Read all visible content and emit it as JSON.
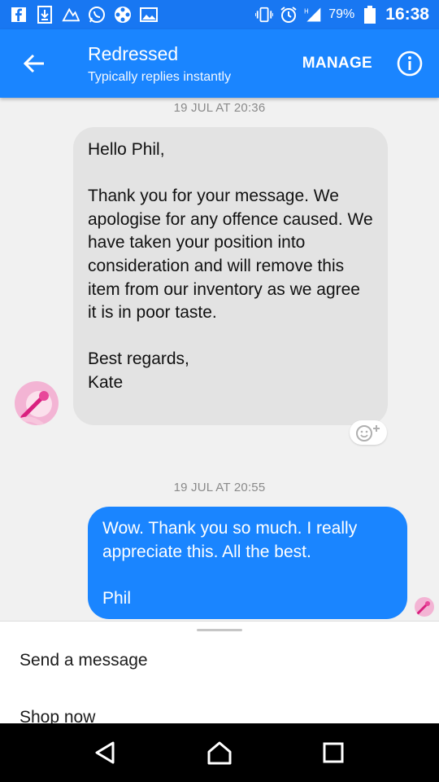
{
  "status_bar": {
    "battery": "79%",
    "time": "16:38",
    "icons": [
      "facebook-icon",
      "download-icon",
      "photo-icon",
      "whatsapp-icon",
      "film-reel-icon",
      "image-icon",
      "vibrate-icon",
      "alarm-icon",
      "signal-icon",
      "battery-icon"
    ]
  },
  "header": {
    "title": "Redressed",
    "subtitle": "Typically replies instantly",
    "manage_label": "MANAGE",
    "accent_color": "#1a85ff"
  },
  "conversation": {
    "messages": [
      {
        "timestamp": "19 JUL AT 20:36",
        "sender": "Kate",
        "direction": "incoming",
        "text": "Hello Phil,\n\nThank you for your message. We apologise for any offence caused. We have taken your position into consideration and will remove this item from our inventory as we agree it is in poor taste.\n\nBest regards,\nKate"
      },
      {
        "timestamp": "19 JUL AT 20:55",
        "sender": "Phil",
        "direction": "outgoing",
        "text": "Wow. Thank you so much. I really appreciate this. All the best.\n\nPhil"
      }
    ]
  },
  "bottom_sheet": {
    "items": [
      {
        "label": "Send a message"
      },
      {
        "label": "Shop now"
      }
    ]
  }
}
